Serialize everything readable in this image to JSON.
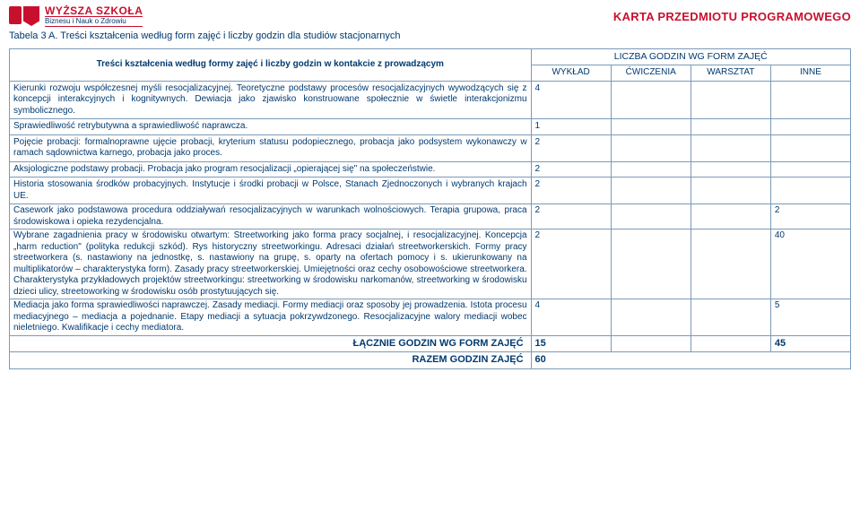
{
  "header": {
    "logo_line1": "WYŻSZA SZKOŁA",
    "logo_line2": "Biznesu i Nauk o Zdrowiu",
    "karta_title": "KARTA PRZEDMIOTU PROGRAMOWEGO"
  },
  "table_label": "Tabela 3 A. Treści kształcenia według form zajęć i liczby godzin dla studiów stacjonarnych",
  "columns": {
    "topic_header": "Treści kształcenia według formy zajęć i liczby godzin w kontakcie z prowadzącym",
    "group_header": "LICZBA GODZIN WG FORM ZAJĘĆ",
    "col_wyklad": "WYKŁAD",
    "col_cwiczenia": "ĆWICZENIA",
    "col_warsztat": "WARSZTAT",
    "col_inne": "INNE"
  },
  "rows": [
    {
      "topic": "Kierunki rozwoju współczesnej myśli resocjalizacyjnej. Teoretyczne podstawy procesów resocjalizacyjnych wywodzących się z koncepcji interakcyjnych i kognitywnych. Dewiacja jako zjawisko konstruowane społecznie w świetle interakcjonizmu symbolicznego.",
      "wyklad": "4",
      "cwiczenia": "",
      "warsztat": "",
      "inne": ""
    },
    {
      "topic": "Sprawiedliwość retrybutywna a sprawiedliwość naprawcza.",
      "wyklad": "1",
      "cwiczenia": "",
      "warsztat": "",
      "inne": ""
    },
    {
      "topic": "Pojęcie probacji: formalnoprawne ujęcie probacji, kryterium statusu podopiecznego, probacja jako podsystem wykonawczy w ramach sądownictwa karnego, probacja jako proces.",
      "wyklad": "2",
      "cwiczenia": "",
      "warsztat": "",
      "inne": ""
    },
    {
      "topic": "Aksjologiczne podstawy probacji. Probacja jako program resocjalizacji „opierającej się\" na społeczeństwie.",
      "wyklad": "2",
      "cwiczenia": "",
      "warsztat": "",
      "inne": ""
    },
    {
      "topic": "Historia stosowania środków probacyjnych. Instytucje i środki probacji w Polsce, Stanach Zjednoczonych i wybranych krajach UE.",
      "wyklad": "2",
      "cwiczenia": "",
      "warsztat": "",
      "inne": ""
    },
    {
      "topic": "Casework jako podstawowa procedura oddziaływań resocjalizacyjnych w warunkach wolnościowych. Terapia grupowa, praca środowiskowa i opieka rezydencjalna.",
      "wyklad": "2",
      "cwiczenia": "",
      "warsztat": "",
      "inne": "2"
    },
    {
      "topic": "Wybrane zagadnienia pracy w środowisku otwartym: Streetworking jako forma pracy socjalnej, i resocjalizacyjnej. Koncepcja „harm reduction\" (polityka redukcji szkód). Rys historyczny streetworkingu. Adresaci działań streetworkerskich. Formy pracy streetworkera (s. nastawiony na jednostkę, s. nastawiony na grupę, s. oparty na ofertach pomocy i s. ukierunkowany na multiplikatorów – charakterystyka form). Zasady pracy streetworkerskiej. Umiejętności oraz cechy osobowościowe streetworkera. Charakterystyka przykładowych projektów streetworkingu: streetworking w środowisku narkomanów, streetworking w środowisku dzieci ulicy, streetoworking w środowisku osób prostytuujących się.",
      "wyklad": "2",
      "cwiczenia": "",
      "warsztat": "",
      "inne": "40"
    },
    {
      "topic": "Mediacja jako forma sprawiedliwości naprawczej. Zasady mediacji. Formy mediacji oraz sposoby jej prowadzenia. Istota procesu mediacyjnego – mediacja a pojednanie. Etapy mediacji a sytuacja pokrzywdzonego. Resocjalizacyjne walory mediacji wobec nieletniego. Kwalifikacje i cechy mediatora.",
      "wyklad": "4",
      "cwiczenia": "",
      "warsztat": "",
      "inne": "5"
    }
  ],
  "sums": {
    "label_form": "ŁĄCZNIE GODZIN WG FORM ZAJĘĆ",
    "wyklad": "15",
    "cwiczenia": "",
    "warsztat": "",
    "inne": "45",
    "label_total": "RAZEM GODZIN ZAJĘĆ",
    "total": "60"
  }
}
